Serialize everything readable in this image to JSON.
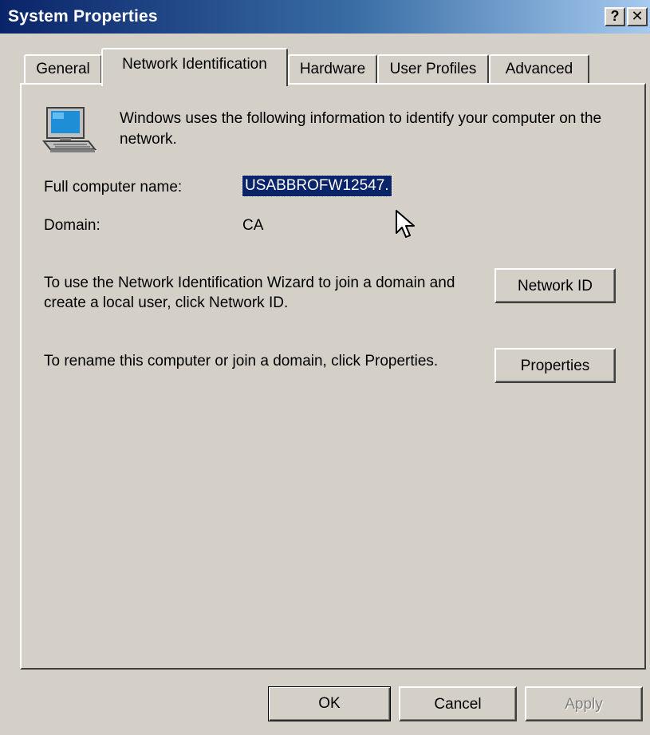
{
  "window": {
    "title": "System Properties",
    "help_label": "?",
    "close_label": "✕"
  },
  "tabs": [
    {
      "label": "General",
      "active": false
    },
    {
      "label": "Network Identification",
      "active": true
    },
    {
      "label": "Hardware",
      "active": false
    },
    {
      "label": "User Profiles",
      "active": false
    },
    {
      "label": "Advanced",
      "active": false
    }
  ],
  "content": {
    "icon": "computer-icon",
    "intro": "Windows uses the following information to identify your computer on the network.",
    "full_computer_name_label": "Full computer name:",
    "full_computer_name_value": "USABBROFW12547.",
    "domain_label": "Domain:",
    "domain_value": "CA",
    "network_id_text": "To use the Network Identification Wizard to join a domain and create a local user, click Network ID.",
    "network_id_button": "Network ID",
    "properties_text": "To rename this computer or join a domain, click Properties.",
    "properties_button": "Properties"
  },
  "footer": {
    "ok_label": "OK",
    "cancel_label": "Cancel",
    "apply_label": "Apply"
  },
  "colors": {
    "title_gradient_start": "#0a246a",
    "title_gradient_end": "#a6caf0",
    "face": "#d4d0c8",
    "selection": "#0a246a"
  }
}
